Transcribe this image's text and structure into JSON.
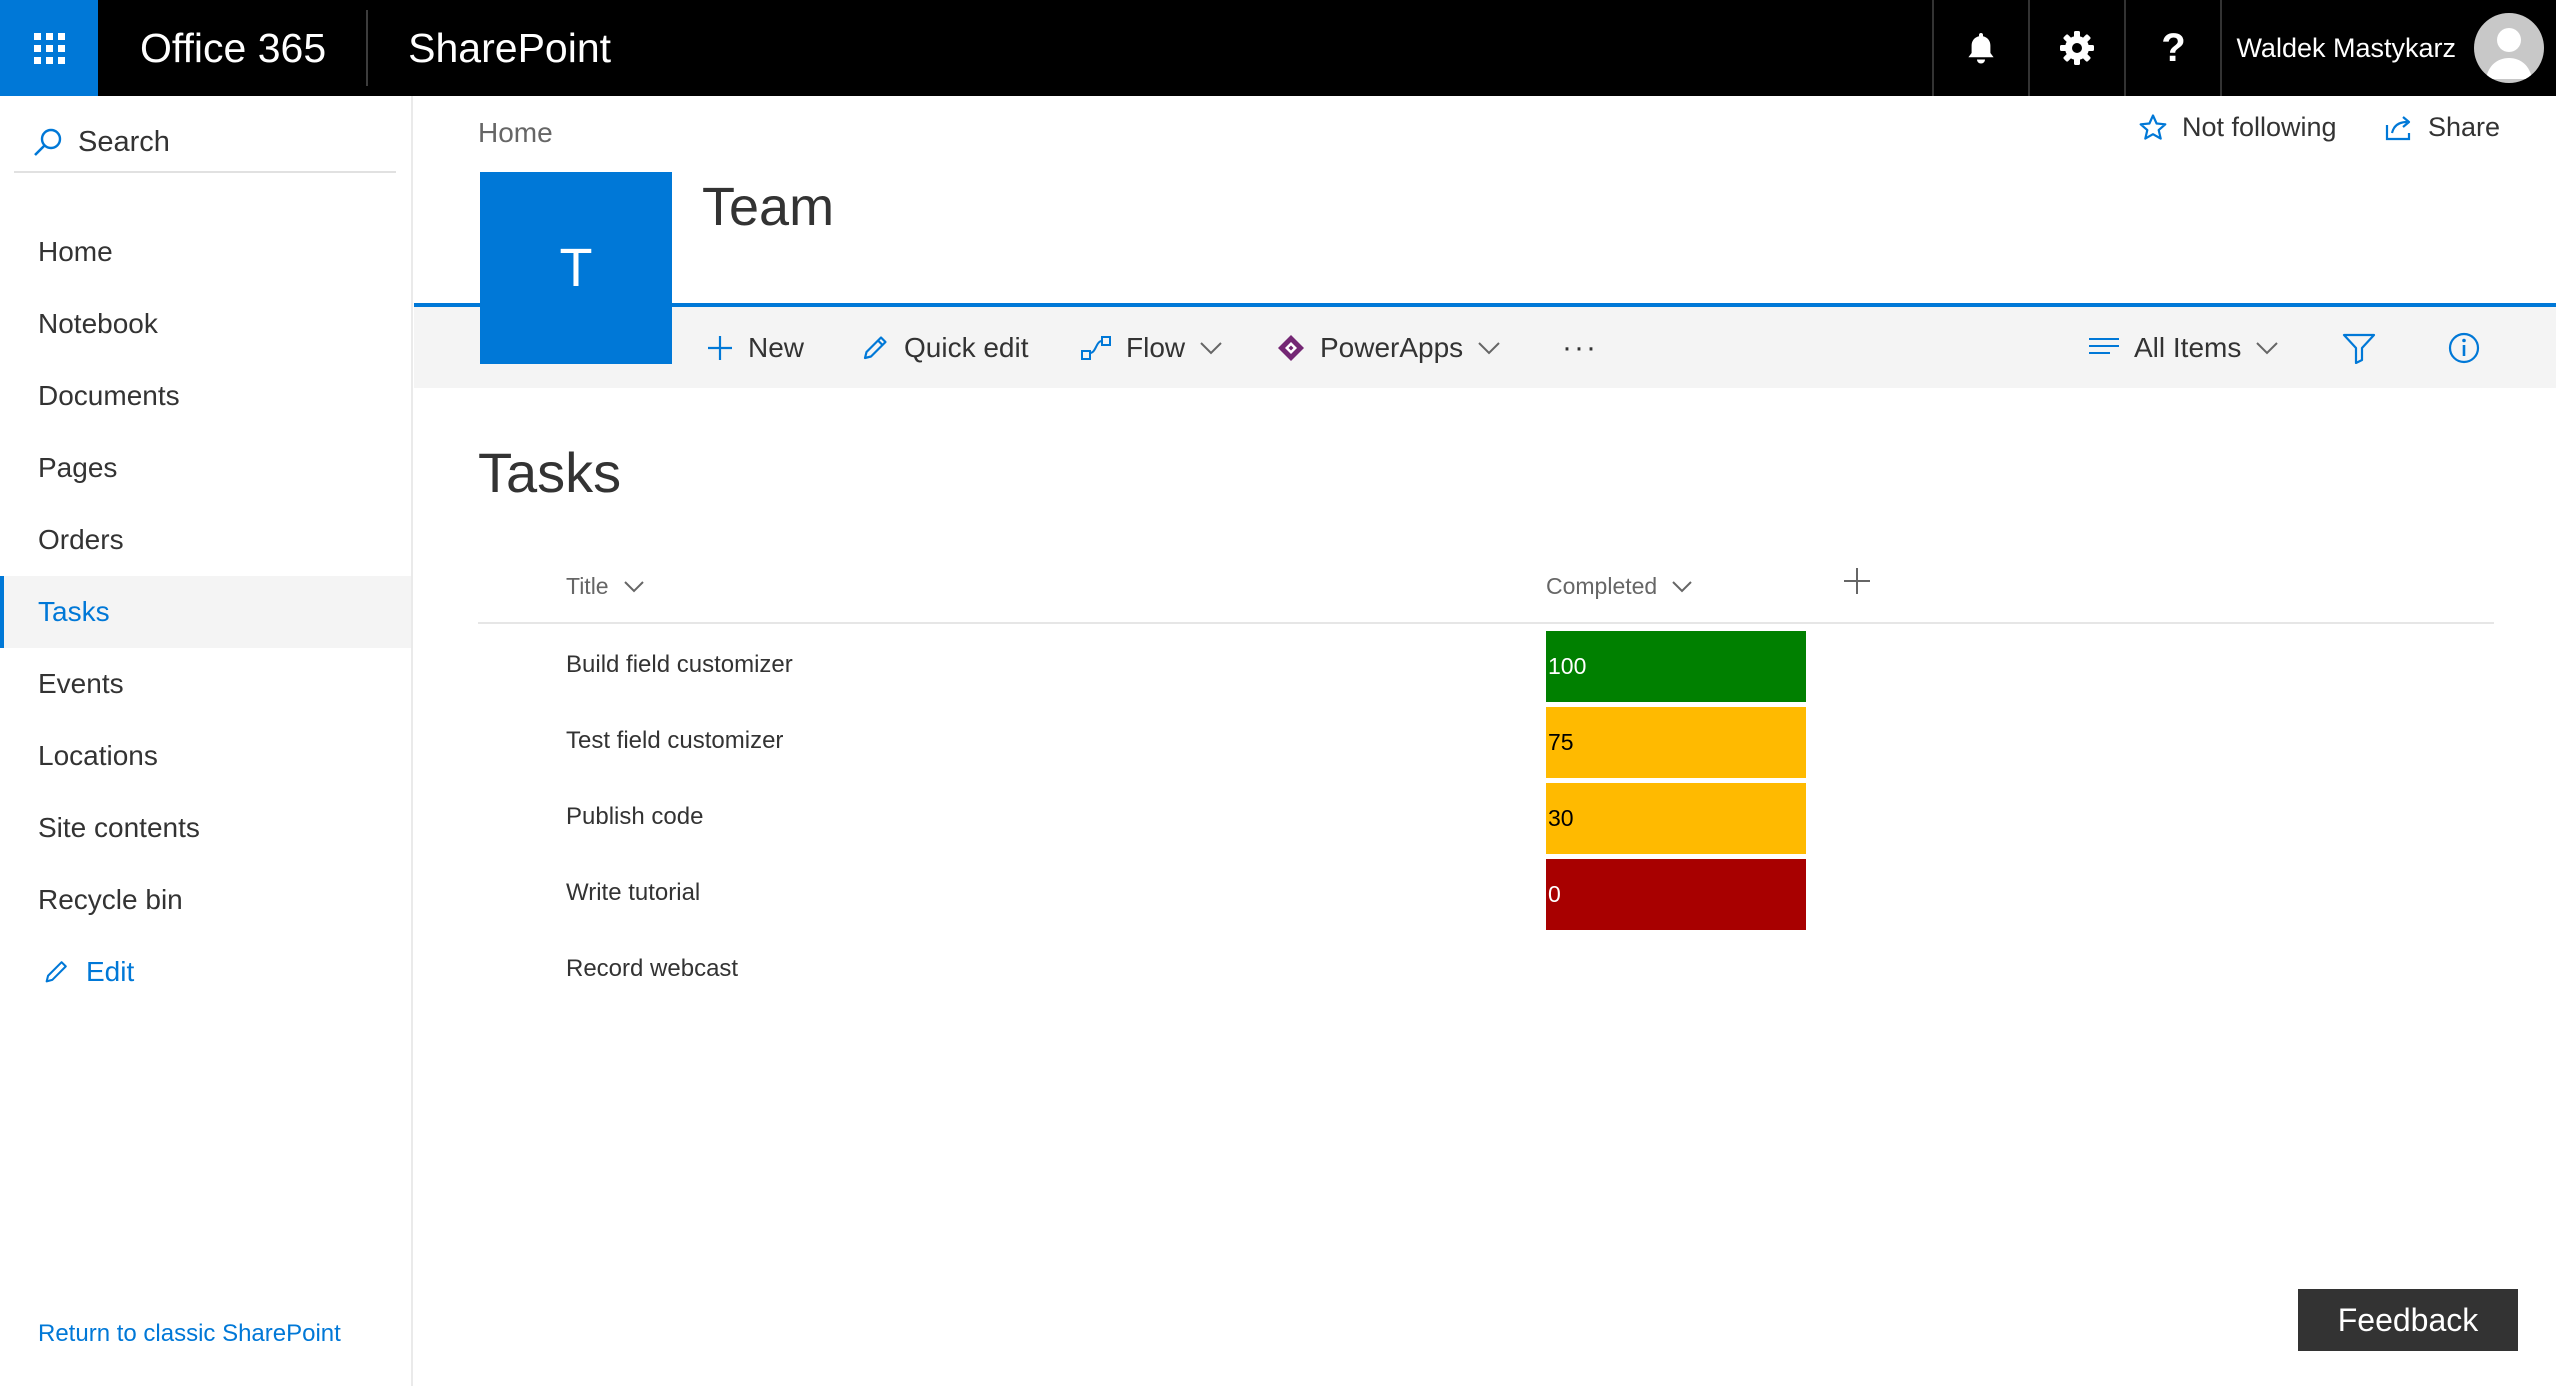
{
  "suite": {
    "brand": "Office 365",
    "app": "SharePoint",
    "user": "Waldek Mastykarz"
  },
  "nav": {
    "search": "Search",
    "items": [
      {
        "label": "Home"
      },
      {
        "label": "Notebook"
      },
      {
        "label": "Documents"
      },
      {
        "label": "Pages"
      },
      {
        "label": "Orders"
      },
      {
        "label": "Tasks",
        "active": true
      },
      {
        "label": "Events"
      },
      {
        "label": "Locations"
      },
      {
        "label": "Site contents"
      },
      {
        "label": "Recycle bin"
      }
    ],
    "edit": "Edit",
    "classic": "Return to classic SharePoint"
  },
  "header": {
    "breadcrumb": "Home",
    "logo_letter": "T",
    "site_title": "Team",
    "follow": "Not following",
    "share": "Share"
  },
  "command_bar": {
    "new": "New",
    "quick_edit": "Quick edit",
    "flow": "Flow",
    "powerapps": "PowerApps",
    "more": "···",
    "view": "All Items"
  },
  "list": {
    "title": "Tasks",
    "columns": {
      "title": "Title",
      "completed": "Completed"
    },
    "rows": [
      {
        "title": "Build field customizer",
        "completed": "100",
        "color": "#008000",
        "text_color": "#ffffff"
      },
      {
        "title": "Test field customizer",
        "completed": "75",
        "color": "#ffba00",
        "text_color": "#000000"
      },
      {
        "title": "Publish code",
        "completed": "30",
        "color": "#ffba00",
        "text_color": "#000000"
      },
      {
        "title": "Write tutorial",
        "completed": "0",
        "color": "#a80000",
        "text_color": "#ffffff"
      },
      {
        "title": "Record webcast",
        "completed": "",
        "color": "",
        "text_color": ""
      }
    ]
  },
  "feedback": "Feedback",
  "colors": {
    "accent": "#0078d7",
    "suitebar": "#000000",
    "powerapps": "#742774"
  }
}
